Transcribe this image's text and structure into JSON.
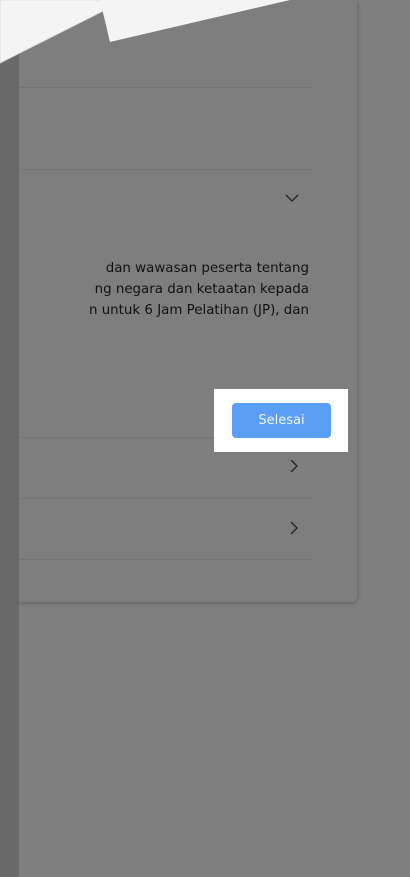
{
  "description": {
    "lines": [
      "dan wawasan peserta tentang",
      "ng negara dan ketaatan kepada",
      "n untuk 6 Jam Pelatihan (JP), dan"
    ]
  },
  "tour": {
    "finish_label": "Selesai"
  },
  "icons": {
    "accordion_toggle": "chevron-down-icon",
    "item_1": "chevron-right-icon",
    "item_2": "chevron-right-icon"
  }
}
